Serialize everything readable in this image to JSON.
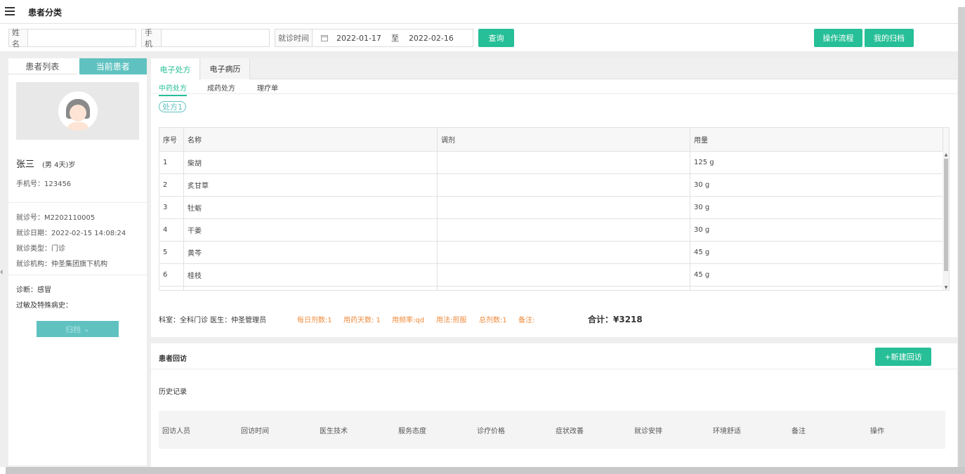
{
  "header": {
    "title": "患者分类"
  },
  "filters": {
    "name_label": "姓名",
    "name_value": "",
    "phone_label": "手机",
    "phone_value": "",
    "date_label": "就诊时间",
    "date_start": "2022-01-17",
    "date_sep": "至",
    "date_end": "2022-02-16",
    "query_button": "查询",
    "workflow_button": "操作流程",
    "my_archive_button": "我的归档"
  },
  "left": {
    "tab_list": "患者列表",
    "tab_current": "当前患者",
    "name": "张三",
    "meta": "(男 4天)岁",
    "phone": "手机号：123456",
    "visit_no": "就诊号：M2202110005",
    "visit_date": "就诊日期：2022-02-15 14:08:24",
    "visit_type": "就诊类型：门诊",
    "institution": "就诊机构：仲圣集团旗下机构",
    "diagnosis": "诊断：感冒",
    "allergy": "过敏及特殊病史：",
    "archive_button": "归档"
  },
  "main": {
    "tabs": [
      "电子处方",
      "电子病历"
    ],
    "subtabs": [
      "中药处方",
      "成药处方",
      "理疗单"
    ],
    "rx_badge": "处方1",
    "columns": [
      "序号",
      "名称",
      "调剂",
      "用量"
    ],
    "rows": [
      {
        "no": "1",
        "name": "柴胡",
        "prep": "",
        "qty": "125 g"
      },
      {
        "no": "2",
        "name": "炙甘草",
        "prep": "",
        "qty": "30 g"
      },
      {
        "no": "3",
        "name": "牡蛎",
        "prep": "",
        "qty": "30 g"
      },
      {
        "no": "4",
        "name": "干姜",
        "prep": "",
        "qty": "30 g"
      },
      {
        "no": "5",
        "name": "黄芩",
        "prep": "",
        "qty": "45 g"
      },
      {
        "no": "6",
        "name": "桂枝",
        "prep": "",
        "qty": "45 g"
      }
    ],
    "summary": {
      "dept_doctor": "科室：全科门诊 医生：仲圣管理员",
      "daily_doses": "每日剂数:1",
      "days": "用药天数: 1",
      "frequency": "用频率:qd",
      "usage": "用法:煎服",
      "total_doses": "总剂数:1",
      "remark": "备注:",
      "total": "合计：¥3218"
    }
  },
  "followup": {
    "title": "患者回访",
    "new_button": "+新建回访",
    "history_label": "历史记录",
    "columns": [
      "回访人员",
      "回访时间",
      "医生技术",
      "服务态度",
      "诊疗价格",
      "症状改善",
      "就诊安排",
      "环境舒适",
      "备注",
      "操作"
    ]
  },
  "colors": {
    "accent": "#26bf97",
    "teal_light": "#5fc2c0",
    "orange": "#f08b3c"
  }
}
